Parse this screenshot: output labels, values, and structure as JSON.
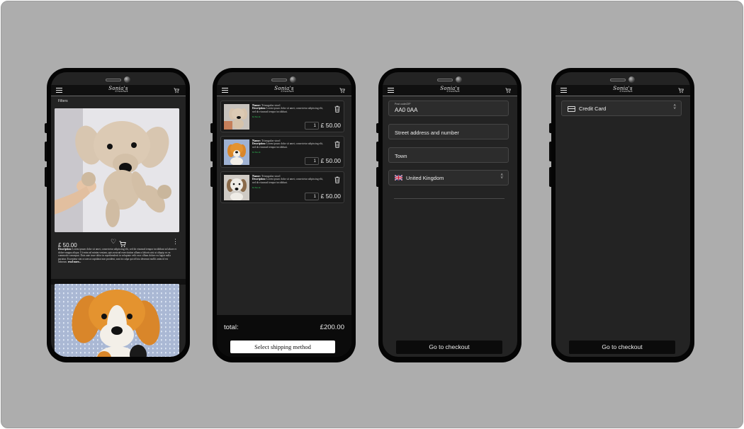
{
  "brand": {
    "logo_main": "Sonia's",
    "logo_sub": "Crochet"
  },
  "screen_catalog": {
    "filters_label": "Filters",
    "product": {
      "price": "£ 50.00",
      "description_label": "Description:",
      "description_text": "Lorem ipsum dolor sit amet, consectetur adipiscing elit, sed do eiusmod tempor incididunt ut labore et dolore magna aliqua. Ut enim ad minim veniam, quis nostrud exercitation ullamco laboris nisi ut aliquip ex ea commodo consequat. Duis aute irure dolor in reprehenderit in voluptate velit esse cillum dolore eu fugiat nulla pariatur. Excepteur sint occaecat cupidatat non proident, sunt in culpa qui officia deserunt mollit anim id est laborum.",
      "read_more": "read more..."
    }
  },
  "screen_cart": {
    "items": [
      {
        "name_label": "Name:",
        "name": "Triangular stool",
        "desc_label": "Description:",
        "desc": "Lorem ipsum dolor sit amet, consectetur adipiscing elit, sed do eiusmod tempor incididunt.",
        "stock": "In Stock",
        "qty": "1",
        "price": "£ 50.00"
      },
      {
        "name_label": "Name:",
        "name": "Triangular stool",
        "desc_label": "Description:",
        "desc": "Lorem ipsum dolor sit amet, consectetur adipiscing elit, sed do eiusmod tempor incididunt.",
        "stock": "In Stock",
        "qty": "1",
        "price": "£ 50.00"
      },
      {
        "name_label": "Name:",
        "name": "Triangular stool",
        "desc_label": "Description:",
        "desc": "Lorem ipsum dolor sit amet, consectetur adipiscing elit, sed do eiusmod tempor incididunt.",
        "stock": "In Stock",
        "qty": "1",
        "price": "£ 50.00"
      }
    ],
    "total_label": "total:",
    "total_value": "£200.00",
    "shipping_button": "Select shipping method"
  },
  "screen_address": {
    "postcode_label": "Post code/ZIP",
    "postcode_value": "AA0 0AA",
    "street_placeholder": "Street address and number",
    "town_placeholder": "Town",
    "country": "United Kingdom",
    "checkout_button": "Go to checkout"
  },
  "screen_payment": {
    "payment_method": "Credit Card",
    "checkout_button": "Go to checkout"
  }
}
